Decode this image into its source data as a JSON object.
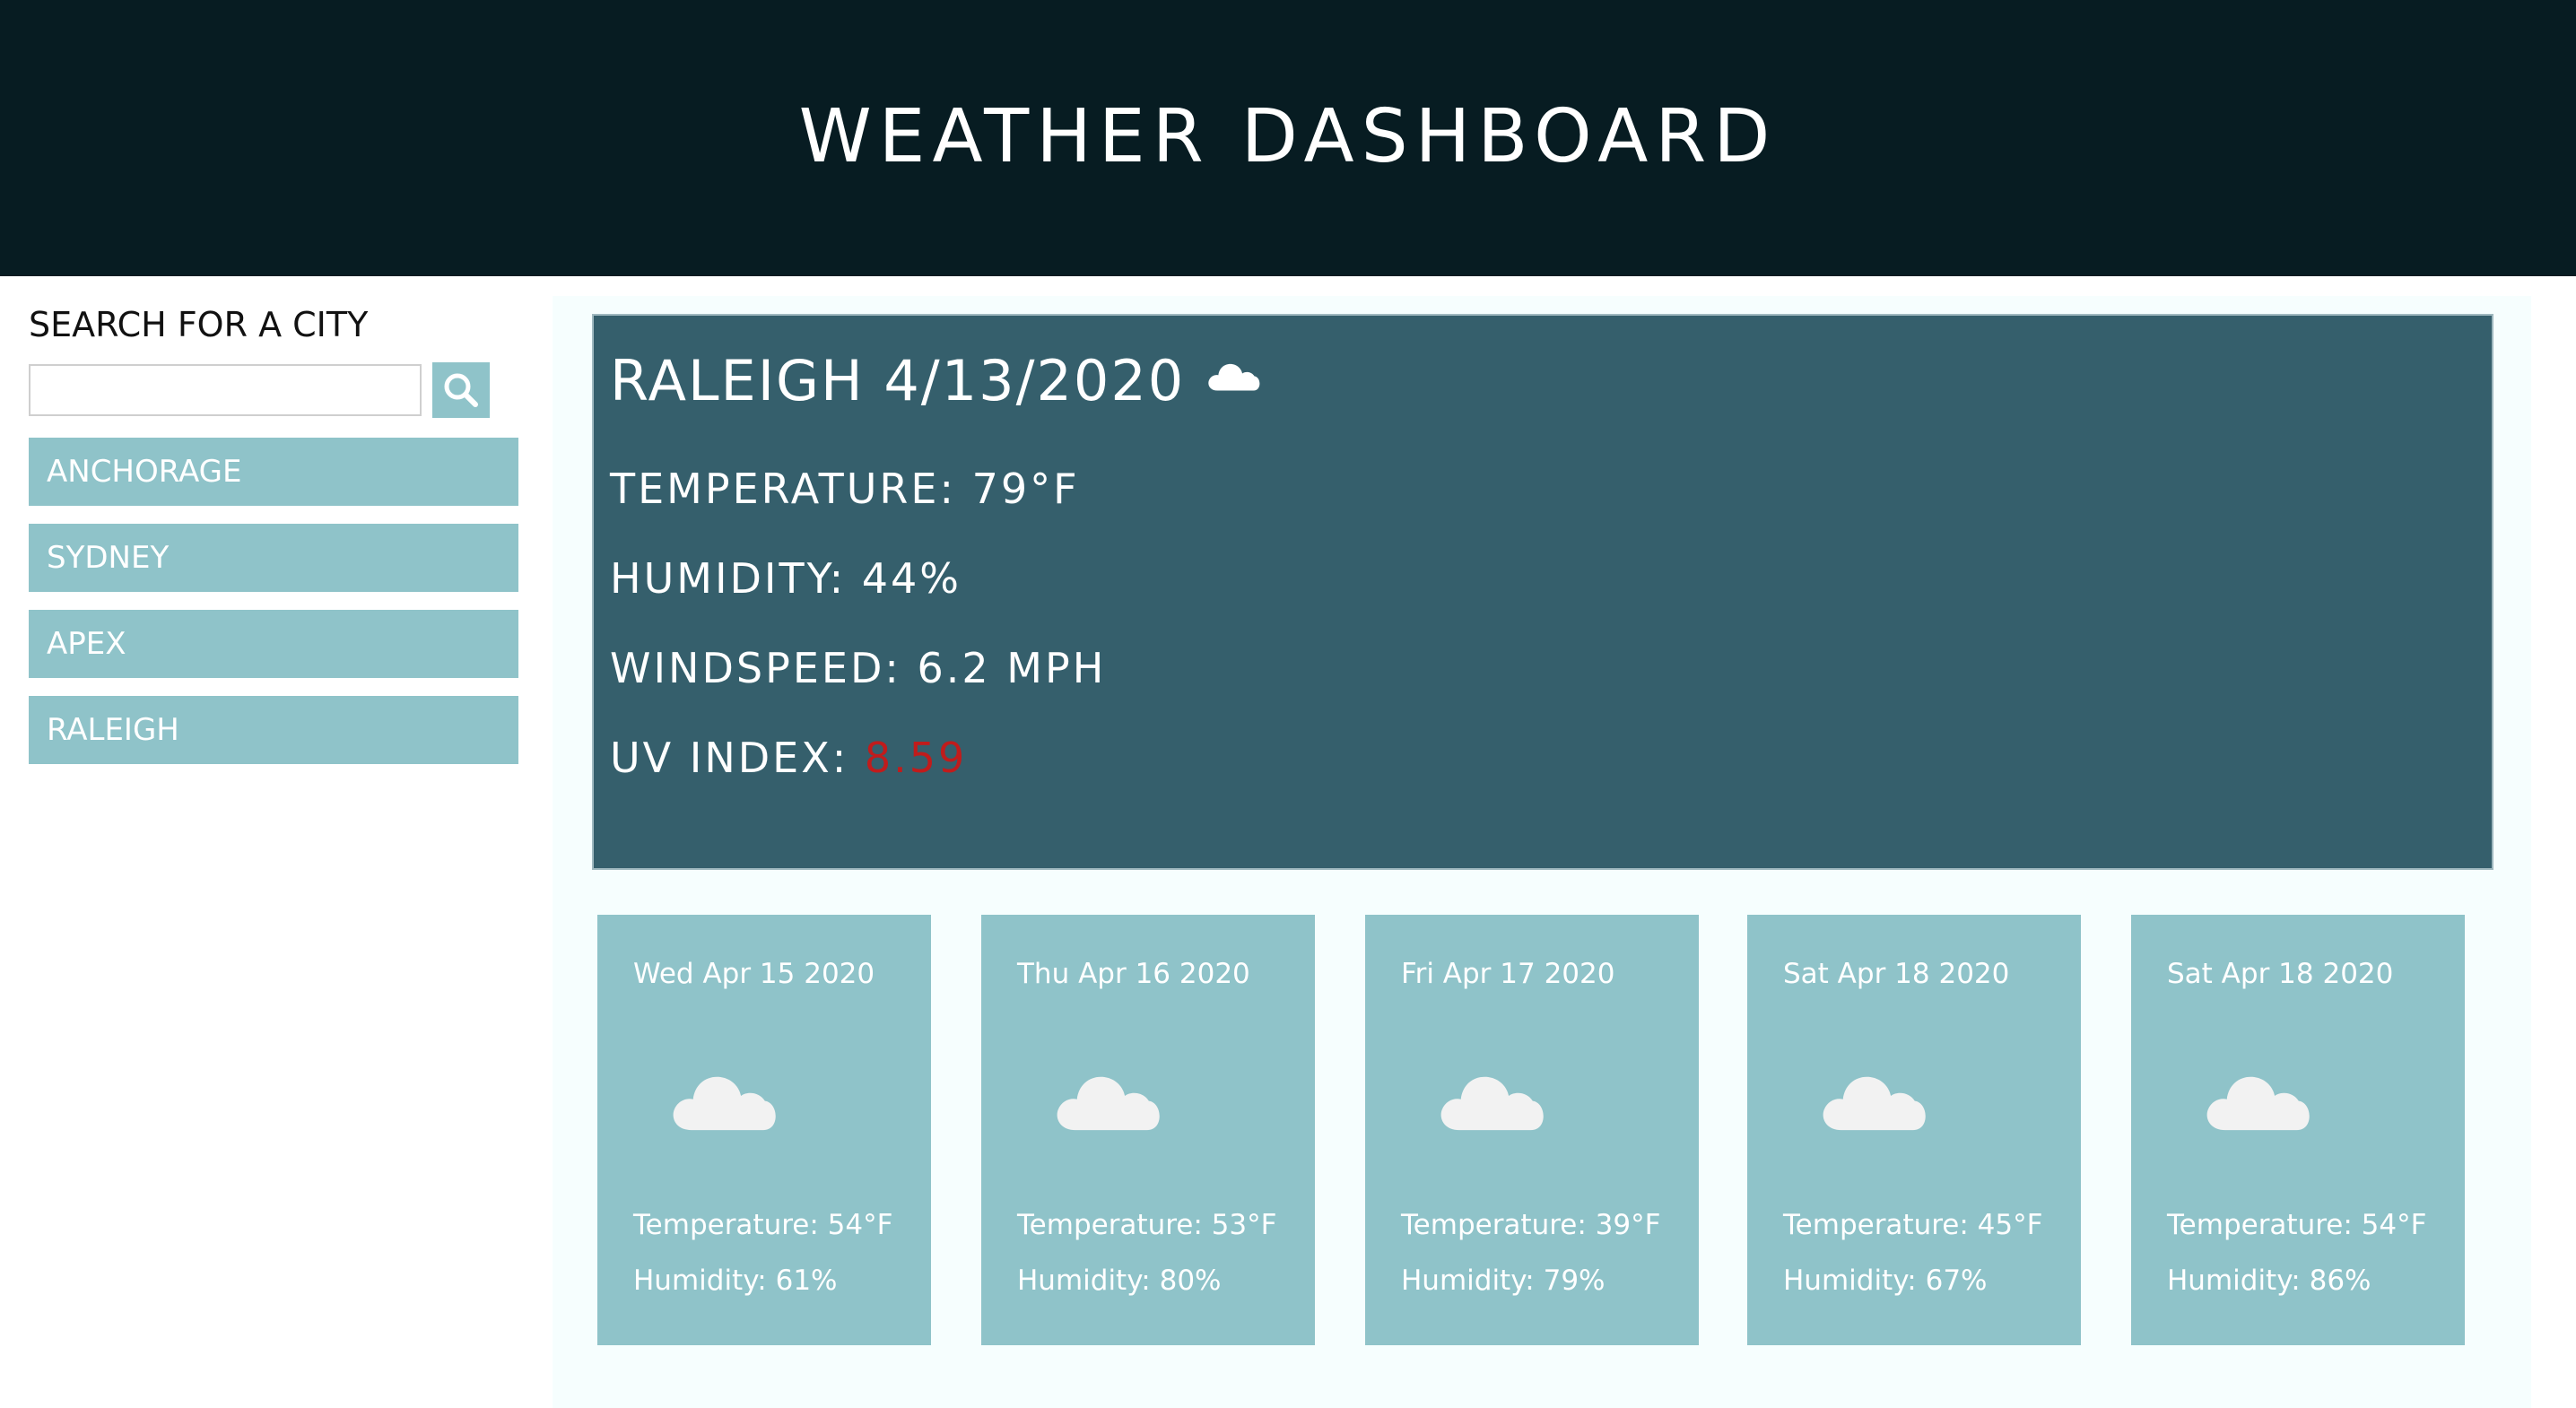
{
  "header": {
    "title": "WEATHER DASHBOARD"
  },
  "sidebar": {
    "search_label": "SEARCH FOR A CITY",
    "search_placeholder": "",
    "search_value": "",
    "search_icon": "magnifier-icon",
    "cities": [
      {
        "label": "ANCHORAGE"
      },
      {
        "label": "SYDNEY"
      },
      {
        "label": "APEX"
      },
      {
        "label": "RALEIGH"
      }
    ]
  },
  "current": {
    "city_date": "RALEIGH 4/13/2020",
    "icon": "cloud-icon",
    "temperature": "TEMPERATURE: 79°F",
    "humidity": "HUMIDITY: 44%",
    "windspeed": "WINDSPEED: 6.2 MPH",
    "uv_label": "UV INDEX: ",
    "uv_value": "8.59"
  },
  "forecast": [
    {
      "date": "Wed Apr 15 2020",
      "icon": "cloud-icon",
      "temperature": "Temperature: 54°F",
      "humidity": "Humidity: 61%"
    },
    {
      "date": "Thu Apr 16 2020",
      "icon": "cloud-icon",
      "temperature": "Temperature: 53°F",
      "humidity": "Humidity: 80%"
    },
    {
      "date": "Fri Apr 17 2020",
      "icon": "cloud-icon",
      "temperature": "Temperature: 39°F",
      "humidity": "Humidity: 79%"
    },
    {
      "date": "Sat Apr 18 2020",
      "icon": "cloud-icon",
      "temperature": "Temperature: 45°F",
      "humidity": "Humidity: 67%"
    },
    {
      "date": "Sat Apr 18 2020",
      "icon": "cloud-icon",
      "temperature": "Temperature: 54°F",
      "humidity": "Humidity: 86%"
    }
  ],
  "colors": {
    "header_bg": "#071c22",
    "accent": "#8fc3c9",
    "current_bg": "#355f6c",
    "uv_alert": "#c01c1c"
  }
}
